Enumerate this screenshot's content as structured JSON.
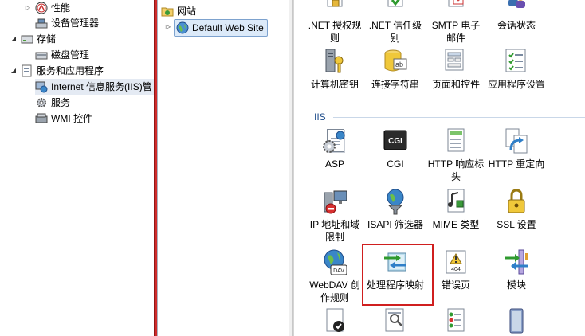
{
  "tree": {
    "items": [
      {
        "label": "性能",
        "icon": "performance-icon"
      },
      {
        "label": "设备管理器",
        "icon": "device-manager-icon"
      },
      {
        "label": "存储",
        "icon": "storage-icon"
      },
      {
        "label": "磁盘管理",
        "icon": "disk-management-icon"
      },
      {
        "label": "服务和应用程序",
        "icon": "services-apps-icon"
      },
      {
        "label": "Internet 信息服务(IIS)管",
        "icon": "iis-manager-icon"
      },
      {
        "label": "服务",
        "icon": "services-icon"
      },
      {
        "label": "WMI 控件",
        "icon": "wmi-icon"
      }
    ]
  },
  "connections": {
    "sites_label": "网站",
    "default_site": "Default Web Site"
  },
  "features": {
    "top_row": [
      ".NET 授权规则",
      ".NET 信任级别",
      "SMTP 电子邮件",
      "会话状态"
    ],
    "row2": [
      "计算机密钥",
      "连接字符串",
      "页面和控件",
      "应用程序设置"
    ],
    "group_iis": "IIS",
    "row3": [
      "ASP",
      "CGI",
      "HTTP 响应标头",
      "HTTP 重定向"
    ],
    "row4": [
      "IP 地址和域限制",
      "ISAPI 筛选器",
      "MIME 类型",
      "SSL 设置"
    ],
    "row5": [
      "WebDAV 创作规则",
      "处理程序映射",
      "错误页",
      "模块"
    ],
    "cgi_badge": "CGI",
    "error_badge": "404",
    "webdav_badge": "DAV"
  },
  "colors": {
    "highlight": "#d01f1f",
    "splitter": "#cf2a2a",
    "group_header": "#1f4e8c"
  }
}
